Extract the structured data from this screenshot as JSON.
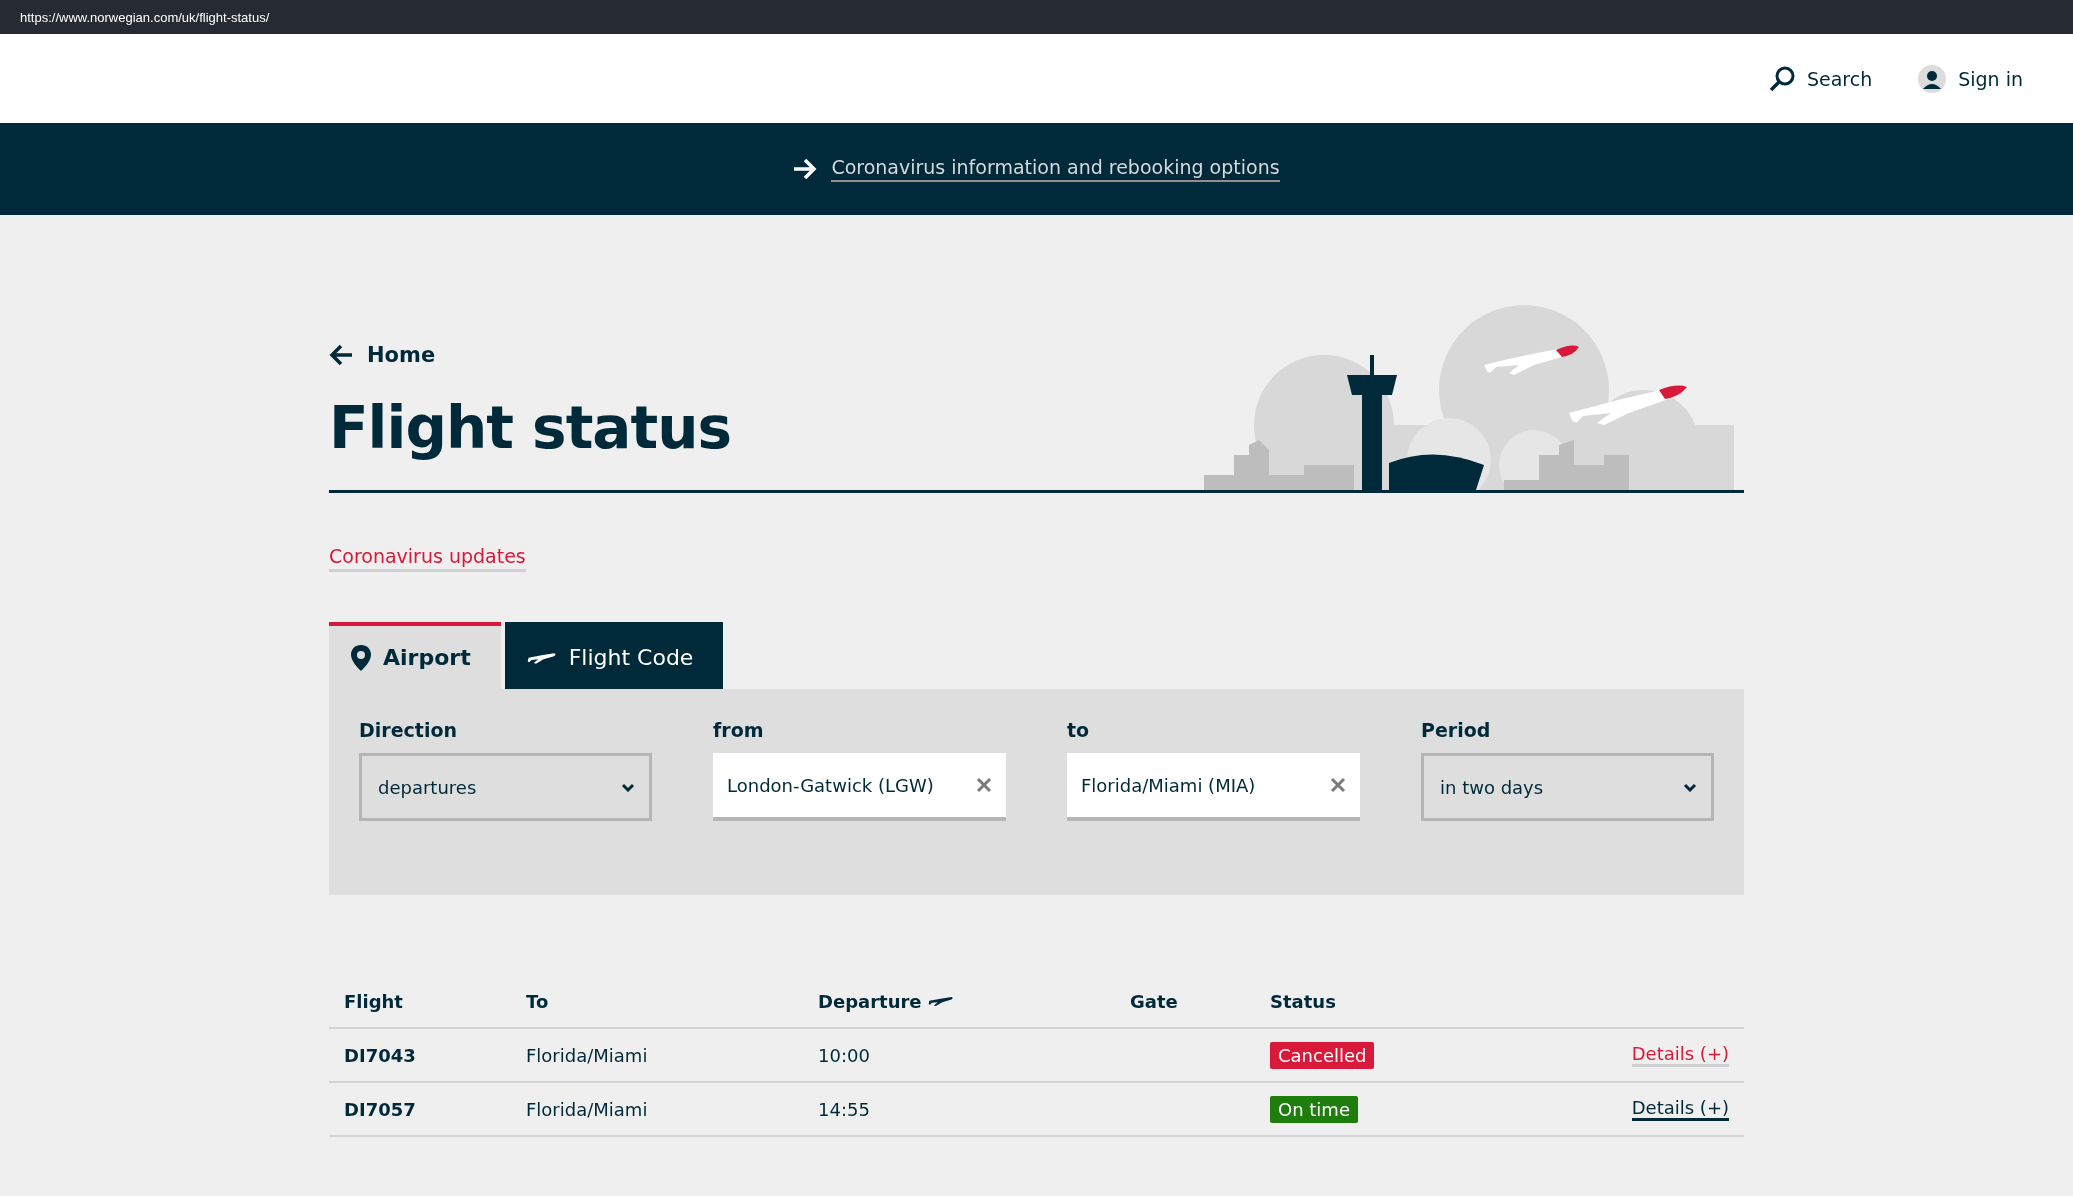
{
  "browser": {
    "url": "https://www.norwegian.com/uk/flight-status/"
  },
  "header": {
    "search": "Search",
    "sign_in": "Sign in"
  },
  "banner": {
    "link": "Coronavirus information and rebooking options"
  },
  "breadcrumb": {
    "back": "Home"
  },
  "title": "Flight status",
  "updates_link": "Coronavirus updates",
  "tabs": [
    {
      "label": "Airport",
      "kind": "airport",
      "selected": true
    },
    {
      "label": "Flight Code",
      "kind": "plane",
      "selected": false
    }
  ],
  "filters": [
    {
      "kind": "select",
      "label": "Direction",
      "value": "departures"
    },
    {
      "kind": "text",
      "label": "from",
      "value": "London-Gatwick (LGW)"
    },
    {
      "kind": "text",
      "label": "to",
      "value": "Florida/Miami (MIA)"
    },
    {
      "kind": "select",
      "label": "Period",
      "value": "in two days"
    }
  ],
  "table": {
    "columns": [
      "Flight",
      "To",
      "Departure",
      "Gate",
      "Status"
    ],
    "rows": [
      {
        "flight": "DI7043",
        "to": "Florida/Miami",
        "departure": "10:00",
        "status": "Cancelled",
        "color": "#d81939",
        "details": "Details (+)",
        "highlighted": true
      },
      {
        "flight": "DI7057",
        "to": "Florida/Miami",
        "departure": "14:55",
        "status": "On time",
        "color": "#1e7d0d",
        "details": "Details (+)",
        "highlighted": false
      }
    ]
  }
}
